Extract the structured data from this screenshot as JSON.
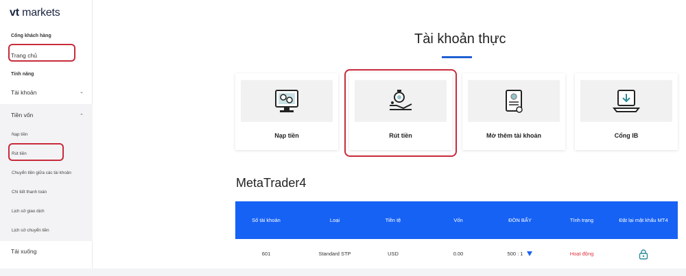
{
  "sidebar": {
    "logo_bold": "vt",
    "logo_text": "markets",
    "portal_section": "Cổng khách hàng",
    "home": "Trang chủ",
    "features_section": "Tính năng",
    "account": "Tài khoản",
    "funds": "Tiền vốn",
    "funds_items": [
      "Nạp tiền",
      "Rút tiền",
      "Chuyển tiền giữa các tài khoản",
      "Chi tiết thanh toán",
      "Lịch sử giao dịch",
      "Lịch sử chuyển tiền"
    ],
    "downloads": "Tải xuống"
  },
  "main": {
    "title": "Tài khoản thực",
    "cards": [
      {
        "label": "Nạp tiền",
        "icon": "deposit-icon"
      },
      {
        "label": "Rút tiền",
        "icon": "withdraw-icon"
      },
      {
        "label": "Mở thêm tài khoản",
        "icon": "open-account-icon"
      },
      {
        "label": "Cổng IB",
        "icon": "ib-portal-icon"
      }
    ],
    "platform_title": "MetaTrader4"
  },
  "table": {
    "headers": [
      "Số tài khoản",
      "Loại",
      "Tiền tệ",
      "Vốn",
      "ĐÒN BẨY",
      "Tình trạng",
      "Đặt lại mật khẩu MT4"
    ],
    "rows": [
      {
        "account": "601",
        "type": "Standard STP",
        "currency": "USD",
        "equity": "0.00",
        "leverage": "500 : 1",
        "status": "Hoạt động"
      }
    ]
  },
  "colors": {
    "accent": "#1662f5",
    "highlight": "#c72a3a",
    "status_active": "#e0323c"
  }
}
